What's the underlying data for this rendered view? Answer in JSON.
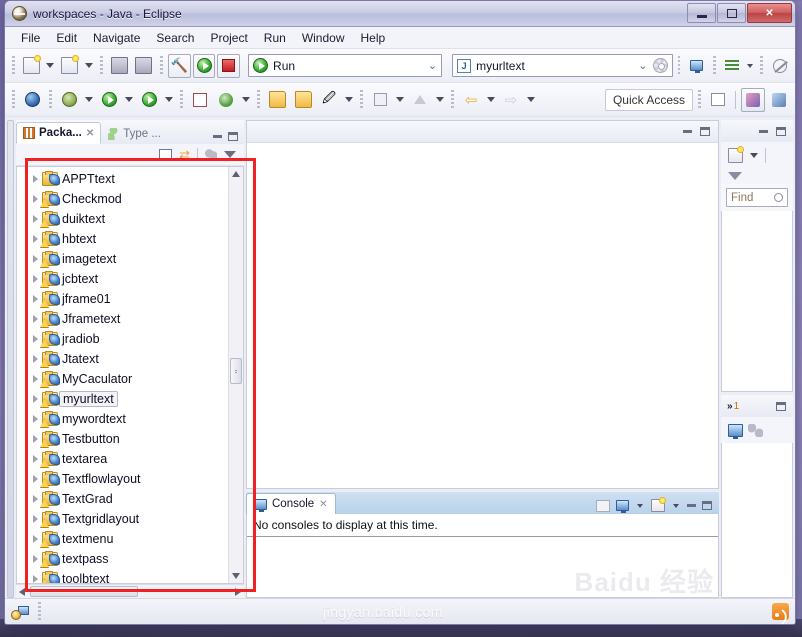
{
  "window": {
    "title": "workspaces - Java - Eclipse",
    "icon": "eclipse-icon",
    "controls": {
      "minimize": "minimize",
      "maximize": "maximize",
      "close": "close"
    }
  },
  "menu": {
    "items": [
      "File",
      "Edit",
      "Navigate",
      "Search",
      "Project",
      "Run",
      "Window",
      "Help"
    ]
  },
  "toolbar": {
    "row1": {
      "new_label": "new-wizard",
      "new_java_label": "new-java-project",
      "save_label": "save",
      "save_all_label": "save-all",
      "build_label": "build",
      "run_label": "run",
      "terminate_label": "terminate",
      "run_config": {
        "value": "Run",
        "icon": "run-green-arrow-icon"
      },
      "launch_config": {
        "value": "myurltext",
        "icon": "java-project-icon"
      },
      "open_console_label": "open-console",
      "skip_breakpoints_label": "skip-all-breakpoints"
    },
    "row2": {
      "debug_label": "debug",
      "run_last_label": "run-last-tool",
      "profile_label": "profile",
      "new_class_label": "new-java-class",
      "new_annotation_label": "new-annotation",
      "open_type_label": "open-type",
      "open_task_label": "open-task",
      "search_label": "search",
      "next_annotation_label": "next-annotation",
      "previous_edit_label": "previous-edit-location",
      "back_label": "back",
      "forward_label": "forward",
      "quick_access": "Quick Access",
      "perspective_java": "java-perspective",
      "perspective_debug": "debug-perspective",
      "open_perspective": "open-perspective"
    }
  },
  "package_explorer": {
    "tabs": [
      {
        "label": "Packa...",
        "icon": "package-explorer-icon",
        "active": true,
        "closable": true
      },
      {
        "label": "Type ...",
        "icon": "type-hierarchy-icon",
        "active": false,
        "closable": false
      }
    ],
    "view_buttons": {
      "minimize": "minimize",
      "maximize": "maximize"
    },
    "toolbar": {
      "collapse_all": "collapse-all-icon",
      "link_with_editor": "link-with-editor-icon",
      "focus_on_active": "focus-on-active-task-icon",
      "view_menu": "view-menu-icon"
    },
    "tree": [
      {
        "label": "APPTtext",
        "warning": false
      },
      {
        "label": "Checkmod",
        "warning": true
      },
      {
        "label": "duiktext",
        "warning": true
      },
      {
        "label": "hbtext",
        "warning": true
      },
      {
        "label": "imagetext",
        "warning": true
      },
      {
        "label": "jcbtext",
        "warning": true
      },
      {
        "label": "jframe01",
        "warning": true
      },
      {
        "label": "Jframetext",
        "warning": true
      },
      {
        "label": "jradiob",
        "warning": true
      },
      {
        "label": "Jtatext",
        "warning": true
      },
      {
        "label": "MyCaculator",
        "warning": true
      },
      {
        "label": "myurltext",
        "warning": true,
        "selected": true
      },
      {
        "label": "mywordtext",
        "warning": true
      },
      {
        "label": "Testbutton",
        "warning": true
      },
      {
        "label": "textarea",
        "warning": true
      },
      {
        "label": "Textflowlayout",
        "warning": true
      },
      {
        "label": "TextGrad",
        "warning": true
      },
      {
        "label": "Textgridlayout",
        "warning": true
      },
      {
        "label": "textmenu",
        "warning": true
      },
      {
        "label": "textpass",
        "warning": true
      },
      {
        "label": "toolbtext",
        "warning": true
      }
    ],
    "annotation": {
      "color": "#ee2222",
      "shape": "rectangle"
    }
  },
  "editor": {
    "view_buttons": {
      "minimize": "minimize",
      "maximize": "maximize"
    },
    "content": ""
  },
  "console": {
    "tab": {
      "label": "Console",
      "icon": "console-icon",
      "closable": true
    },
    "message": "No consoles to display at this time.",
    "toolbar": {
      "open_console": "open-console-icon",
      "display_selected": "display-selected-console-icon",
      "display_menu": "display-console-menu-icon",
      "new_console": "new-console-view-icon",
      "new_console_menu": "new-console-menu-icon",
      "minimize": "minimize",
      "maximize": "maximize"
    },
    "watermark": "Baidu 经验"
  },
  "task_list": {
    "view_buttons": {
      "minimize": "minimize",
      "maximize": "maximize"
    },
    "toolbar": {
      "new_task": "new-task-icon",
      "new_task_menu": "new-task-menu-icon",
      "filter": "filter-icon"
    },
    "find": {
      "placeholder": "Find",
      "value": "",
      "icon": "search-icon"
    }
  },
  "outline": {
    "overflow_chevron": "»",
    "overflow_count": "1",
    "view_buttons": {
      "maximize": "maximize"
    },
    "toolbar": {
      "console_icon": "console-icon",
      "outline_icon": "outline-icon"
    }
  },
  "status_bar": {
    "icon": "build-status-icon",
    "watermark": "jingyan.baidu.com",
    "rss_icon": "rss-icon"
  }
}
